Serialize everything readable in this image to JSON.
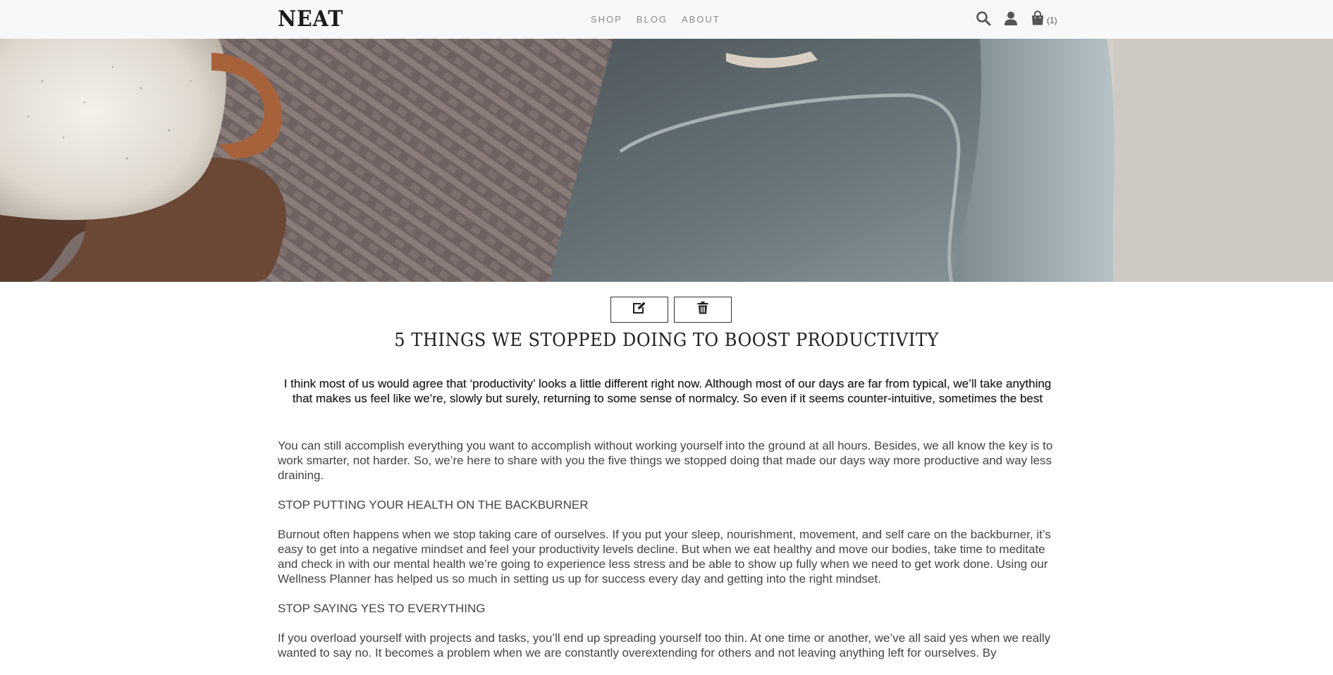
{
  "header": {
    "logo": "NEAT",
    "nav": [
      "SHOP",
      "BLOG",
      "ABOUT"
    ],
    "icons": [
      "search-icon",
      "user-icon",
      "shopping-bag-icon"
    ],
    "cart_count": "(1)"
  },
  "hero": {
    "image_description_icon": "hero-image"
  },
  "actions": {
    "edit_icon": "edit-icon",
    "delete_icon": "trash-icon"
  },
  "article": {
    "title": "5 THINGS WE STOPPED DOING TO BOOST PRODUCTIVITY",
    "intro": "I think most of us would agree that ‘productivity’ looks a little different right now. Although most of our days are far from typical, we’ll take anything that makes us feel like we’re, slowly but surely, returning to some sense of normalcy. So even if it seems counter-intuitive, sometimes the best",
    "paragraphs": [
      "You can still accomplish everything you want to accomplish without working yourself into the ground at all hours. Besides, we all know the key is to work smarter, not harder. So, we’re here to share with you the five things we stopped doing that made our days way more productive and way less draining.",
      "STOP PUTTING YOUR HEALTH ON THE BACKBURNER",
      "Burnout often happens when we stop taking care of ourselves. If you put your sleep, nourishment, movement, and self care on the backburner, it’s easy to get into a negative mindset and feel your productivity levels decline. But when we eat healthy and move our bodies, take time to meditate and check in with our mental health we’re going to experience less stress and be able to show up fully when we need to get work done. Using our Wellness Planner has helped us so much in setting us up for success every day and getting into the right mindset.",
      "STOP SAYING YES TO EVERYTHING",
      "If you overload yourself with projects and tasks, you’ll end up spreading yourself too thin. At one time or another, we’ve all said yes when we really wanted to say no. It becomes a problem when we are constantly overextending for others and not leaving anything left for ourselves. By"
    ]
  }
}
